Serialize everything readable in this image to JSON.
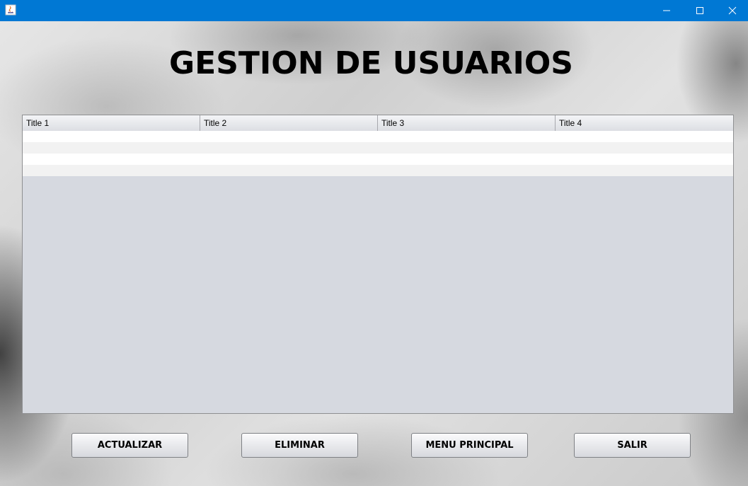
{
  "window": {
    "icons": {
      "app": "java-icon",
      "minimize": "minimize-icon",
      "maximize": "maximize-icon",
      "close": "close-icon"
    },
    "titlebar_color": "#0078d4"
  },
  "page": {
    "title": "GESTION DE USUARIOS"
  },
  "table": {
    "columns": [
      "Title 1",
      "Title 2",
      "Title 3",
      "Title 4"
    ],
    "rows": [
      [
        "",
        "",
        "",
        ""
      ],
      [
        "",
        "",
        "",
        ""
      ],
      [
        "",
        "",
        "",
        ""
      ],
      [
        "",
        "",
        "",
        ""
      ]
    ]
  },
  "buttons": {
    "update": "ACTUALIZAR",
    "delete": "ELIMINAR",
    "main_menu": "MENU PRINCIPAL",
    "exit": "SALIR"
  }
}
